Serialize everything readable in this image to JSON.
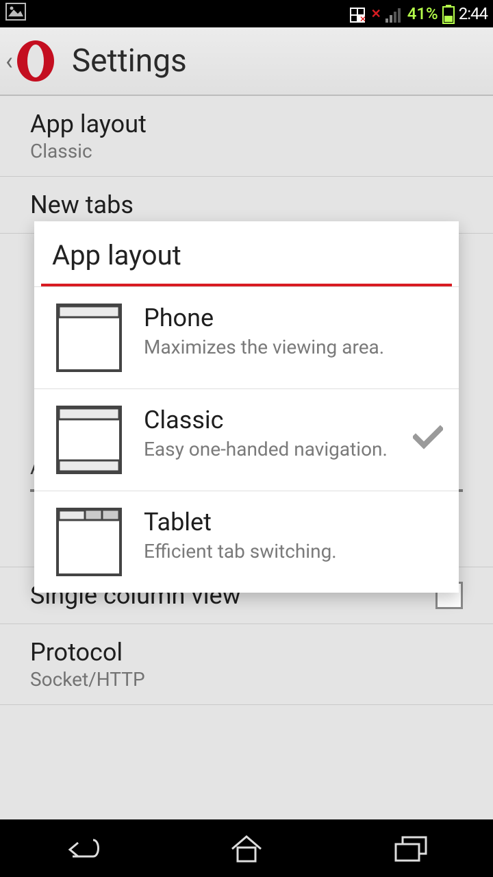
{
  "statusbar": {
    "battery": "41%",
    "time": "2:44"
  },
  "header": {
    "title": "Settings"
  },
  "settings": {
    "app_layout": {
      "title": "App layout",
      "value": "Classic"
    },
    "new_tabs": {
      "title": "New tabs"
    },
    "advanced_heading": "Advanced",
    "single_column": {
      "title": "Single column view"
    },
    "protocol": {
      "title": "Protocol",
      "value": "Socket/HTTP"
    }
  },
  "dialog": {
    "title": "App layout",
    "options": [
      {
        "title": "Phone",
        "desc": "Maximizes the viewing area.",
        "selected": false
      },
      {
        "title": "Classic",
        "desc": "Easy one-handed navigation.",
        "selected": true
      },
      {
        "title": "Tablet",
        "desc": "Efficient tab switching.",
        "selected": false
      }
    ]
  }
}
